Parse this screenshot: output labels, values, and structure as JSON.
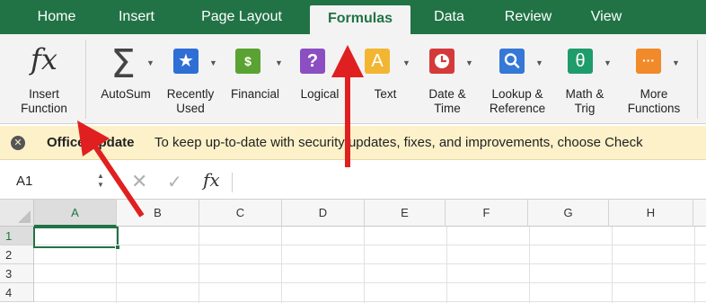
{
  "tabs": [
    {
      "label": "Home",
      "active": false
    },
    {
      "label": "Insert",
      "active": false
    },
    {
      "label": "Page Layout",
      "active": false
    },
    {
      "label": "Formulas",
      "active": true
    },
    {
      "label": "Data",
      "active": false
    },
    {
      "label": "Review",
      "active": false
    },
    {
      "label": "View",
      "active": false
    }
  ],
  "ribbon": {
    "insert_function": {
      "glyph": "fx",
      "label_line1": "Insert",
      "label_line2": "Function"
    },
    "autosum": {
      "glyph": "Σ",
      "label_line1": "AutoSum"
    },
    "recently_used": {
      "glyph": "★",
      "label_line1": "Recently",
      "label_line2": "Used",
      "icon_color": "#2e6ed5"
    },
    "financial": {
      "glyph": "$",
      "label_line1": "Financial",
      "icon_color": "#5aa232"
    },
    "logical": {
      "glyph": "?",
      "label_line1": "Logical",
      "icon_color": "#8b4fc2"
    },
    "text": {
      "glyph": "A",
      "label_line1": "Text",
      "icon_color": "#f2b632"
    },
    "date_time": {
      "glyph": "clock",
      "label_line1": "Date &",
      "label_line2": "Time",
      "icon_color": "#d53a3a"
    },
    "lookup_reference": {
      "glyph": "magnifier",
      "label_line1": "Lookup &",
      "label_line2": "Reference",
      "icon_color": "#3578d6"
    },
    "math_trig": {
      "glyph": "θ",
      "label_line1": "Math &",
      "label_line2": "Trig",
      "icon_color": "#1f9c6b"
    },
    "more_functions": {
      "glyph": "···",
      "label_line1": "More",
      "label_line2": "Functions",
      "icon_color": "#f08a2a"
    }
  },
  "message_bar": {
    "title": "Office Update",
    "text": "To keep up-to-date with security updates, fixes, and improvements, choose Check"
  },
  "formula_bar": {
    "name_box": "A1",
    "cancel_glyph": "✕",
    "enter_glyph": "✓",
    "fx_glyph": "fx",
    "formula": ""
  },
  "grid": {
    "columns": [
      "A",
      "B",
      "C",
      "D",
      "E",
      "F",
      "G",
      "H"
    ],
    "rows": [
      "1",
      "2",
      "3",
      "4"
    ],
    "selected_cell": "A1"
  },
  "colors": {
    "excel_green": "#217346",
    "ribbon_bg": "#f3f3f3",
    "message_bg": "#fcf1c9",
    "annotation_red": "#e02020"
  }
}
